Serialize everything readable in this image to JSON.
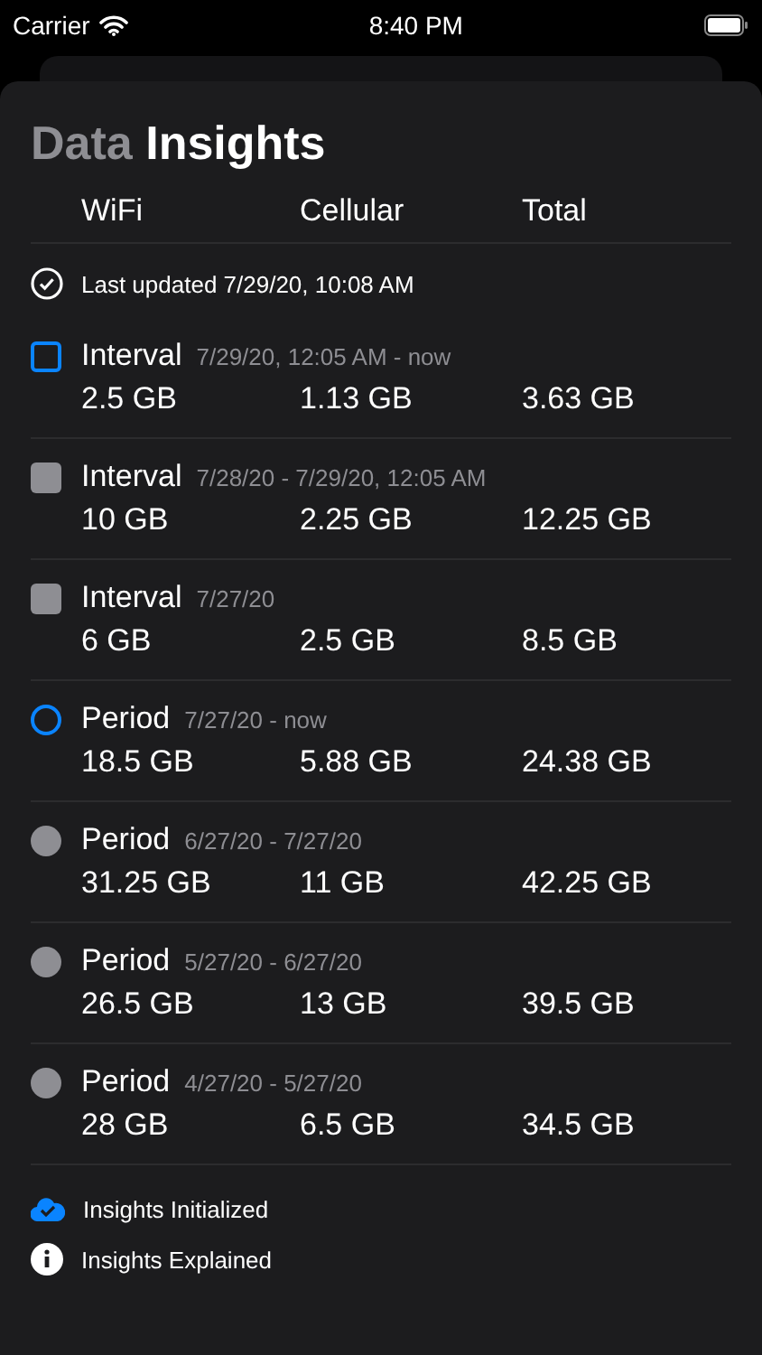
{
  "status_bar": {
    "carrier": "Carrier",
    "time": "8:40 PM"
  },
  "title": {
    "muted": "Data",
    "main": "Insights"
  },
  "columns": [
    "WiFi",
    "Cellular",
    "Total"
  ],
  "last_updated": "Last updated 7/29/20, 10:08 AM",
  "rows": [
    {
      "kind": "interval",
      "selected": true,
      "label": "Interval",
      "range": "7/29/20, 12:05 AM - now",
      "values": [
        "2.5 GB",
        "1.13 GB",
        "3.63 GB"
      ]
    },
    {
      "kind": "interval",
      "selected": false,
      "label": "Interval",
      "range": "7/28/20 - 7/29/20, 12:05 AM",
      "values": [
        "10 GB",
        "2.25 GB",
        "12.25 GB"
      ]
    },
    {
      "kind": "interval",
      "selected": false,
      "label": "Interval",
      "range": "7/27/20",
      "values": [
        "6 GB",
        "2.5 GB",
        "8.5 GB"
      ]
    },
    {
      "kind": "period",
      "selected": true,
      "label": "Period",
      "range": "7/27/20 - now",
      "values": [
        "18.5 GB",
        "5.88 GB",
        "24.38 GB"
      ]
    },
    {
      "kind": "period",
      "selected": false,
      "label": "Period",
      "range": "6/27/20 - 7/27/20",
      "values": [
        "31.25 GB",
        "11 GB",
        "42.25 GB"
      ]
    },
    {
      "kind": "period",
      "selected": false,
      "label": "Period",
      "range": "5/27/20 - 6/27/20",
      "values": [
        "26.5 GB",
        "13 GB",
        "39.5 GB"
      ]
    },
    {
      "kind": "period",
      "selected": false,
      "label": "Period",
      "range": "4/27/20 - 5/27/20",
      "values": [
        "28 GB",
        "6.5 GB",
        "34.5 GB"
      ]
    }
  ],
  "footer": [
    {
      "kind": "cloud",
      "label": "Insights Initialized"
    },
    {
      "kind": "info",
      "label": "Insights Explained"
    }
  ]
}
